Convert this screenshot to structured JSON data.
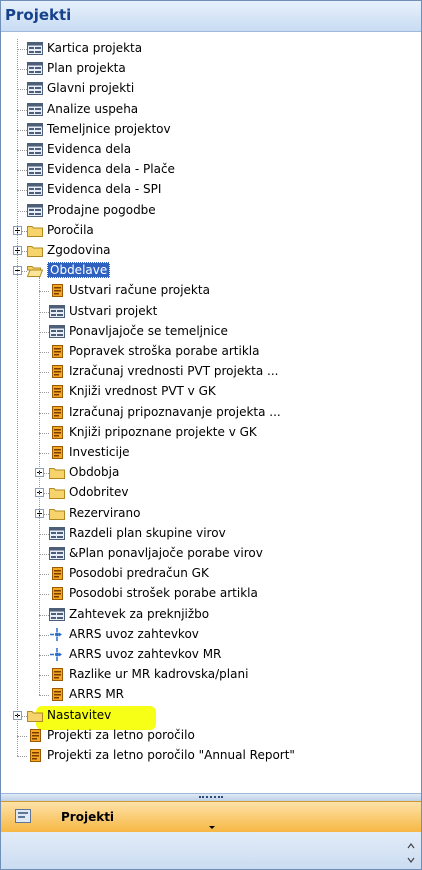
{
  "panel": {
    "title": "Projekti",
    "items": [
      {
        "label": "Kartica projekta",
        "icon": "form-icon",
        "level": 1,
        "expander": null
      },
      {
        "label": "Plan projekta",
        "icon": "form-icon",
        "level": 1,
        "expander": null
      },
      {
        "label": "Glavni projekti",
        "icon": "form-icon",
        "level": 1,
        "expander": null
      },
      {
        "label": "Analize uspeha",
        "icon": "form-icon",
        "level": 1,
        "expander": null
      },
      {
        "label": "Temeljnice projektov",
        "icon": "form-icon",
        "level": 1,
        "expander": null
      },
      {
        "label": "Evidenca dela",
        "icon": "form-icon",
        "level": 1,
        "expander": null
      },
      {
        "label": "Evidenca dela - Plače",
        "icon": "form-icon",
        "level": 1,
        "expander": null
      },
      {
        "label": "Evidenca dela - SPI",
        "icon": "form-icon",
        "level": 1,
        "expander": null
      },
      {
        "label": "Prodajne pogodbe",
        "icon": "form-icon",
        "level": 1,
        "expander": null
      },
      {
        "label": "Poročila",
        "icon": "folder-icon",
        "level": 1,
        "expander": "plus"
      },
      {
        "label": "Zgodovina",
        "icon": "folder-icon",
        "level": 1,
        "expander": "plus"
      },
      {
        "label": "Obdelave",
        "icon": "folder-open-icon",
        "level": 1,
        "expander": "minus",
        "selected": true
      },
      {
        "label": "Ustvari račune projekta",
        "icon": "report-icon",
        "level": 2,
        "expander": null
      },
      {
        "label": "Ustvari projekt",
        "icon": "form-icon",
        "level": 2,
        "expander": null
      },
      {
        "label": "Ponavljajoče se temeljnice",
        "icon": "form-icon",
        "level": 2,
        "expander": null
      },
      {
        "label": "Popravek stroška porabe artikla",
        "icon": "report-icon",
        "level": 2,
        "expander": null
      },
      {
        "label": "Izračunaj vrednosti PVT projekta ...",
        "icon": "report-icon",
        "level": 2,
        "expander": null
      },
      {
        "label": "Knjiži vrednost PVT v GK",
        "icon": "report-icon",
        "level": 2,
        "expander": null
      },
      {
        "label": "Izračunaj pripoznavanje projekta ...",
        "icon": "report-icon",
        "level": 2,
        "expander": null
      },
      {
        "label": "Knjiži pripoznane projekte v GK",
        "icon": "report-icon",
        "level": 2,
        "expander": null
      },
      {
        "label": "Investicije",
        "icon": "report-icon",
        "level": 2,
        "expander": null
      },
      {
        "label": "Obdobja",
        "icon": "folder-icon",
        "level": 2,
        "expander": "plus"
      },
      {
        "label": "Odobritev",
        "icon": "folder-icon",
        "level": 2,
        "expander": "plus"
      },
      {
        "label": "Rezervirano",
        "icon": "folder-icon",
        "level": 2,
        "expander": "plus"
      },
      {
        "label": "Razdeli plan skupine virov",
        "icon": "form-icon",
        "level": 2,
        "expander": null
      },
      {
        "label": "&Plan ponavljajoče porabe virov",
        "icon": "form-icon",
        "level": 2,
        "expander": null
      },
      {
        "label": "Posodobi predračun GK",
        "icon": "report-icon",
        "level": 2,
        "expander": null
      },
      {
        "label": "Posodobi strošek porabe artikla",
        "icon": "report-icon",
        "level": 2,
        "expander": null
      },
      {
        "label": "Zahtevek za preknjižbo",
        "icon": "form-icon",
        "level": 2,
        "expander": null
      },
      {
        "label": "ARRS uvoz zahtevkov",
        "icon": "dataport-icon",
        "level": 2,
        "expander": null
      },
      {
        "label": "ARRS uvoz zahtevkov MR",
        "icon": "dataport-icon",
        "level": 2,
        "expander": null
      },
      {
        "label": "Razlike ur MR kadrovska/plani",
        "icon": "report-icon",
        "level": 2,
        "expander": null
      },
      {
        "label": "ARRS MR",
        "icon": "report-icon",
        "level": 2,
        "expander": null,
        "highlighted": true
      },
      {
        "label": "Nastavitev",
        "icon": "folder-icon",
        "level": 1,
        "expander": "plus"
      },
      {
        "label": "Projekti za letno poročilo",
        "icon": "report-icon",
        "level": 1,
        "expander": null
      },
      {
        "label": "Projekti za letno poročilo \"Annual Report\"",
        "icon": "report-icon",
        "level": 1,
        "expander": null
      }
    ]
  },
  "nav": {
    "label": "Projekti",
    "icon": "projects-nav-icon"
  },
  "colors": {
    "highlight": "#f7ff16",
    "selection": "#2f62c0",
    "nav_orange": "#f7b744",
    "header_text": "#15428b"
  }
}
